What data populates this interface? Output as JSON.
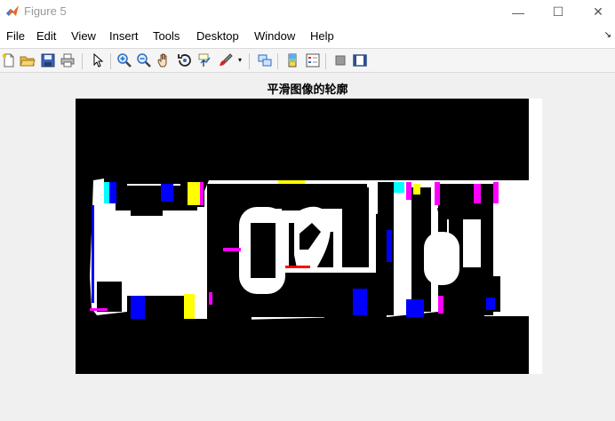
{
  "window": {
    "title": "Figure 5",
    "minimize_glyph": "—",
    "maximize_glyph": "☐",
    "close_glyph": "✕"
  },
  "menu": {
    "items": [
      "File",
      "Edit",
      "View",
      "Insert",
      "Tools",
      "Desktop",
      "Window",
      "Help"
    ],
    "dock_glyph": "↘"
  },
  "toolbar": {
    "buttons": [
      "new-figure-icon",
      "open-file-icon",
      "save-figure-icon",
      "print-figure-icon",
      "edit-plot-arrow-icon",
      "zoom-in-icon",
      "zoom-out-icon",
      "pan-hand-icon",
      "rotate-3d-icon",
      "data-cursor-icon",
      "brush-icon",
      "link-plot-icon",
      "insert-colorbar-icon",
      "insert-legend-icon",
      "hide-plot-tools-icon",
      "show-plot-tools-icon"
    ]
  },
  "figure": {
    "title": "平滑图像的轮廓",
    "background": "#000000",
    "foreground": "#ffffff",
    "edge_colors": [
      "#0000ff",
      "#ffff00",
      "#ff00ff",
      "#00ffff",
      "#ff0000"
    ]
  }
}
